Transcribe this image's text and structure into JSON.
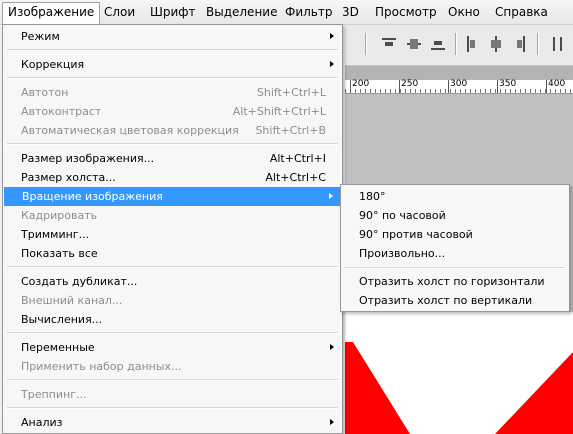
{
  "menubar": {
    "items": [
      {
        "label": "Изображение"
      },
      {
        "label": "Слои"
      },
      {
        "label": "Шрифт"
      },
      {
        "label": "Выделение"
      },
      {
        "label": "Фильтр"
      },
      {
        "label": "3D"
      },
      {
        "label": "Просмотр"
      },
      {
        "label": "Окно"
      },
      {
        "label": "Справка"
      }
    ]
  },
  "image_menu": {
    "items": [
      {
        "label": "Режим",
        "shortcut": "",
        "submenu": true,
        "enabled": true
      },
      {
        "label": "Коррекция",
        "shortcut": "",
        "submenu": true,
        "enabled": true
      },
      {
        "label": "Автотон",
        "shortcut": "Shift+Ctrl+L",
        "enabled": false
      },
      {
        "label": "Автоконтраст",
        "shortcut": "Alt+Shift+Ctrl+L",
        "enabled": false
      },
      {
        "label": "Автоматическая цветовая коррекция",
        "shortcut": "Shift+Ctrl+B",
        "enabled": false
      },
      {
        "label": "Размер изображения...",
        "shortcut": "Alt+Ctrl+I",
        "enabled": true
      },
      {
        "label": "Размер холста...",
        "shortcut": "Alt+Ctrl+C",
        "enabled": true
      },
      {
        "label": "Вращение изображения",
        "shortcut": "",
        "submenu": true,
        "enabled": true,
        "highlighted": true
      },
      {
        "label": "Кадрировать",
        "shortcut": "",
        "enabled": false
      },
      {
        "label": "Тримминг...",
        "shortcut": "",
        "enabled": true
      },
      {
        "label": "Показать все",
        "shortcut": "",
        "enabled": true
      },
      {
        "label": "Создать дубликат...",
        "shortcut": "",
        "enabled": true
      },
      {
        "label": "Внешний канал...",
        "shortcut": "",
        "enabled": false
      },
      {
        "label": "Вычисления...",
        "shortcut": "",
        "enabled": true
      },
      {
        "label": "Переменные",
        "shortcut": "",
        "submenu": true,
        "enabled": true
      },
      {
        "label": "Применить набор данных...",
        "shortcut": "",
        "enabled": false
      },
      {
        "label": "Треппинг...",
        "shortcut": "",
        "enabled": false
      },
      {
        "label": "Анализ",
        "shortcut": "",
        "submenu": true,
        "enabled": true
      }
    ]
  },
  "rotation_submenu": {
    "items": [
      {
        "label": "180°"
      },
      {
        "label": "90° по часовой"
      },
      {
        "label": "90° против часовой"
      },
      {
        "label": "Произвольно..."
      },
      {
        "label": "Отразить холст по горизонтали"
      },
      {
        "label": "Отразить холст по вертикали"
      }
    ]
  },
  "ruler": {
    "labels": [
      "200",
      "250",
      "300",
      "350",
      "400"
    ]
  },
  "colors": {
    "highlight": "#3399ff",
    "canvas_shape": "#ff0000"
  },
  "icons": [
    "align-top-icon",
    "align-vcenter-icon",
    "align-bottom-icon",
    "align-left-icon",
    "align-hcenter-icon",
    "align-right-icon",
    "distribute-icon"
  ]
}
